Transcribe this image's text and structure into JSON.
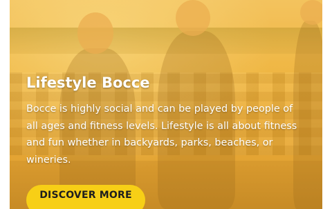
{
  "card": {
    "title": "Lifestyle Bocce",
    "description": "Bocce is highly social and can be played by people of all ages and fitness levels. Lifestyle is all about fitness and fun whether in backyards, parks, beaches, or wineries.",
    "cta_label": "DISCOVER MORE"
  },
  "colors": {
    "overlay": "#f0b94a",
    "cta_background": "#f7cf16",
    "text": "#ffffff"
  }
}
